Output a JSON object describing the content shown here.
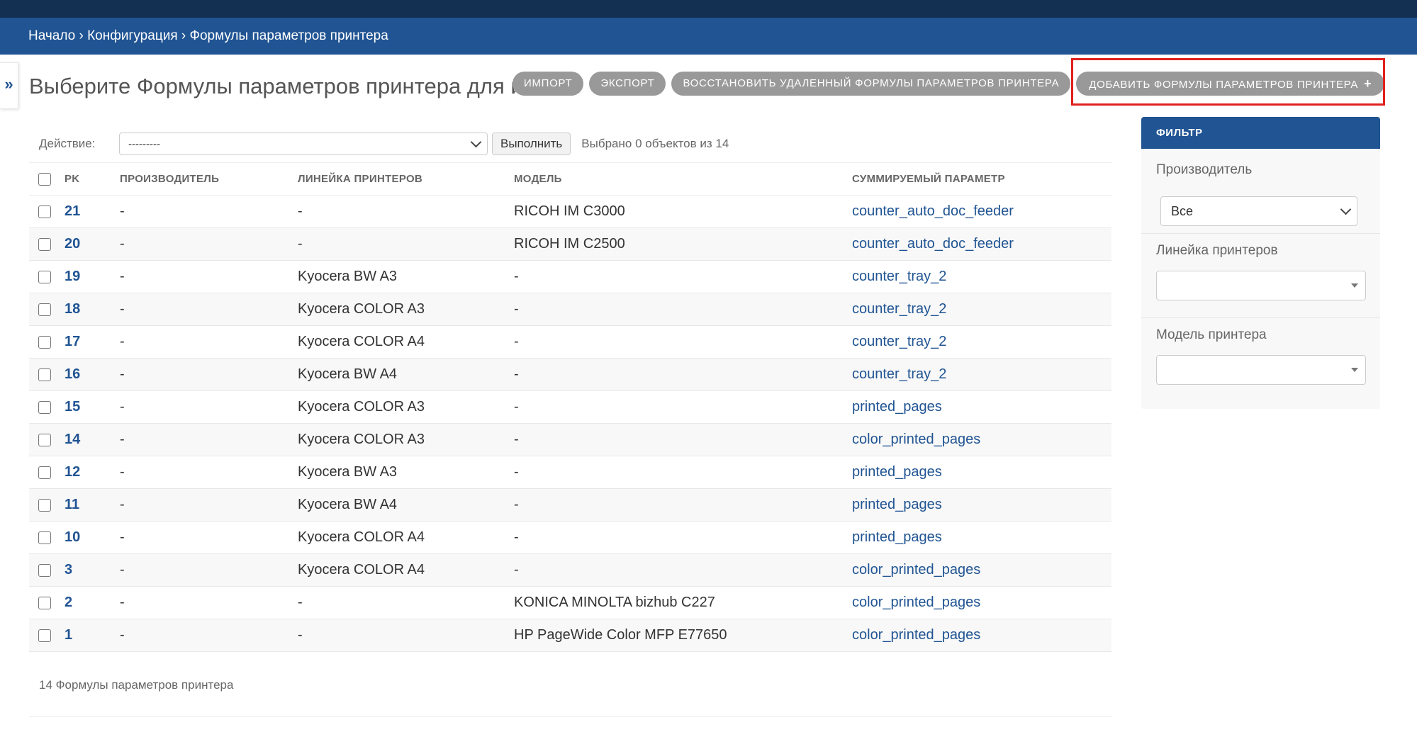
{
  "breadcrumbs": {
    "home": "Начало",
    "config": "Конфигурация",
    "current": "Формулы параметров принтера",
    "sep": "›"
  },
  "sidebar_toggle": "»",
  "page_title": "Выберите Формулы параметров принтера для изменения",
  "tools": {
    "import": "ИМПОРТ",
    "export": "ЭКСПОРТ",
    "recover": "ВОССТАНОВИТЬ УДАЛЕННЫЙ ФОРМУЛЫ ПАРАМЕТРОВ ПРИНТЕРА",
    "add": "ДОБАВИТЬ ФОРМУЛЫ ПАРАМЕТРОВ ПРИНТЕРА",
    "add_icon": "+"
  },
  "highlight_color": "#e0201c",
  "actions": {
    "label": "Действие:",
    "selected": "---------",
    "go": "Выполнить",
    "counter": "Выбрано 0 объектов из 14"
  },
  "table": {
    "headers": {
      "pk": "PK",
      "manufacturer": "ПРОИЗВОДИТЕЛЬ",
      "line": "ЛИНЕЙКА ПРИНТЕРОВ",
      "model": "МОДЕЛЬ",
      "param": "СУММИРУЕМЫЙ ПАРАМЕТР"
    },
    "rows": [
      {
        "pk": "21",
        "manufacturer": "-",
        "line": "-",
        "model": "RICOH IM C3000",
        "param": "counter_auto_doc_feeder"
      },
      {
        "pk": "20",
        "manufacturer": "-",
        "line": "-",
        "model": "RICOH IM C2500",
        "param": "counter_auto_doc_feeder"
      },
      {
        "pk": "19",
        "manufacturer": "-",
        "line": "Kyocera BW A3",
        "model": "-",
        "param": "counter_tray_2"
      },
      {
        "pk": "18",
        "manufacturer": "-",
        "line": "Kyocera COLOR A3",
        "model": "-",
        "param": "counter_tray_2"
      },
      {
        "pk": "17",
        "manufacturer": "-",
        "line": "Kyocera COLOR A4",
        "model": "-",
        "param": "counter_tray_2"
      },
      {
        "pk": "16",
        "manufacturer": "-",
        "line": "Kyocera BW A4",
        "model": "-",
        "param": "counter_tray_2"
      },
      {
        "pk": "15",
        "manufacturer": "-",
        "line": "Kyocera COLOR A3",
        "model": "-",
        "param": "printed_pages"
      },
      {
        "pk": "14",
        "manufacturer": "-",
        "line": "Kyocera COLOR A3",
        "model": "-",
        "param": "color_printed_pages"
      },
      {
        "pk": "12",
        "manufacturer": "-",
        "line": "Kyocera BW A3",
        "model": "-",
        "param": "printed_pages"
      },
      {
        "pk": "11",
        "manufacturer": "-",
        "line": "Kyocera BW A4",
        "model": "-",
        "param": "printed_pages"
      },
      {
        "pk": "10",
        "manufacturer": "-",
        "line": "Kyocera COLOR A4",
        "model": "-",
        "param": "printed_pages"
      },
      {
        "pk": "3",
        "manufacturer": "-",
        "line": "Kyocera COLOR A4",
        "model": "-",
        "param": "color_printed_pages"
      },
      {
        "pk": "2",
        "manufacturer": "-",
        "line": "-",
        "model": "KONICA MINOLTA bizhub C227",
        "param": "color_printed_pages"
      },
      {
        "pk": "1",
        "manufacturer": "-",
        "line": "-",
        "model": "HP PageWide Color MFP E77650",
        "param": "color_printed_pages"
      }
    ]
  },
  "paginator": "14 Формулы параметров принтера",
  "filter": {
    "title": "ФИЛЬТР",
    "manufacturer_label": "Производитель",
    "manufacturer_value": "Все",
    "line_label": "Линейка принтеров",
    "line_value": "",
    "model_label": "Модель принтера",
    "model_value": ""
  }
}
